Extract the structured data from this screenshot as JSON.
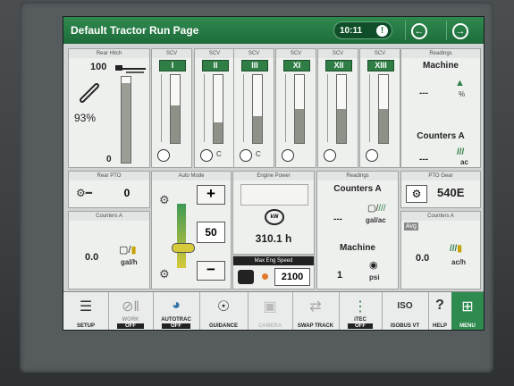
{
  "header": {
    "title": "Default Tractor Run Page",
    "time": "10:11",
    "warn_glyph": "!",
    "back_glyph": "←",
    "forward_glyph": "→"
  },
  "rear_hitch": {
    "title": "Rear Hitch",
    "max": "100",
    "min": "0",
    "percent": "93%"
  },
  "scvs": [
    {
      "title": "SCV",
      "label": "I",
      "level": 0.55
    },
    {
      "title": "SCV",
      "label": "II",
      "level": 0.3,
      "mode": "C"
    },
    {
      "title": "SCV",
      "label": "III",
      "level": 0.4,
      "mode": "C"
    },
    {
      "title": "SCV",
      "label": "XI",
      "level": 0.5
    },
    {
      "title": "SCV",
      "label": "XII",
      "level": 0.5
    },
    {
      "title": "SCV",
      "label": "XIII",
      "level": 0.5
    }
  ],
  "readings_top": {
    "title": "Readings",
    "machine": "Machine",
    "machine_value": "---",
    "machine_unit": "%",
    "counters": "Counters A",
    "counters_value": "---",
    "counters_unit": "ac"
  },
  "rear_pto": {
    "title": "Rear PTO",
    "value": "0"
  },
  "counters_left": {
    "title": "Counters A",
    "value": "0.0",
    "unit": "gal/h"
  },
  "auto_mode": {
    "title": "Auto Mode",
    "plus": "+",
    "value": "50",
    "minus": "−"
  },
  "engine": {
    "title": "Engine Power",
    "value": "310.1 h",
    "icon_label": "kW"
  },
  "max_speed": {
    "title": "Max Eng Speed",
    "value": "2100"
  },
  "readings_mid": {
    "title": "Readings",
    "counters": "Counters A",
    "value": "---",
    "unit": "gal/ac",
    "machine": "Machine",
    "machine_value": "1",
    "machine_unit": "psi"
  },
  "pto_gear": {
    "title": "PTO Gear",
    "value": "540E"
  },
  "counters_right": {
    "title": "Counters A",
    "avg": "Avg",
    "value": "0.0",
    "unit": "ac/h"
  },
  "bottom": {
    "setup": "SETUP",
    "work": "WORK",
    "work_state": "OFF",
    "autotrac": "AUTOTRAC",
    "autotrac_state": "OFF",
    "guidance": "GUIDANCE",
    "camera": "CAMERA",
    "swap": "SWAP TRACK",
    "itec": "iTEC",
    "itec_state": "OFF",
    "isobus": "ISOBUS VT",
    "isobus_icon": "ISO",
    "help": "HELP",
    "menu": "MENU"
  }
}
